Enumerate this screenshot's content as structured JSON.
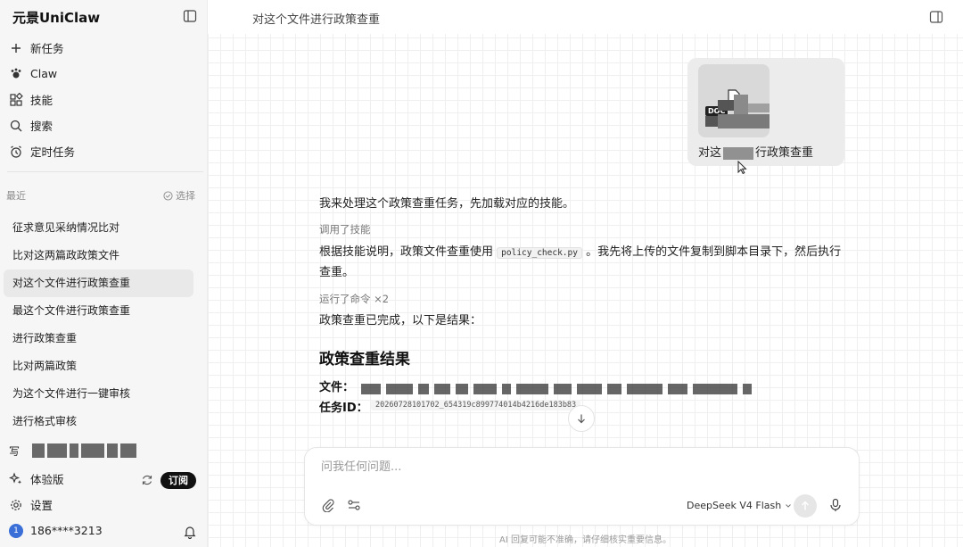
{
  "app": {
    "brand": "元景UniClaw"
  },
  "nav": [
    {
      "label": "新任务",
      "icon": "plus-icon"
    },
    {
      "label": "Claw",
      "icon": "claw-icon"
    },
    {
      "label": "技能",
      "icon": "skills-icon"
    },
    {
      "label": "搜索",
      "icon": "search-icon"
    },
    {
      "label": "定时任务",
      "icon": "alarm-clock-icon"
    }
  ],
  "recent": {
    "heading": "最近",
    "select_label": "选择",
    "items": [
      "征求意见采纳情况比对",
      "比对这两篇政政策文件",
      "对这个文件进行政策查重",
      "最这个文件进行政策查重",
      "进行政策查重",
      "比对两篇政策",
      "为这个文件进行一键审核",
      "进行格式审核"
    ],
    "truncated_item_prefix": "写"
  },
  "bottom": {
    "plan_label": "体验版",
    "subscribe_label": "订阅",
    "settings_label": "设置",
    "account": "186****3213",
    "avatar_initial": "1"
  },
  "header": {
    "title": "对这个文件进行政策查重"
  },
  "attachment": {
    "badge": "DOC",
    "name_prefix": "对这",
    "name_suffix": "行政策查重"
  },
  "conversation": {
    "msg1": "我来处理这个政策查重任务，先加载对应的技能。",
    "meta1": "调用了技能",
    "msg2_before": "根据技能说明，政策文件查重使用",
    "msg2_code": "policy_check.py",
    "msg2_after": "。我先将上传的文件复制到脚本目录下，然后执行查重。",
    "meta2": "运行了命令 ×2",
    "msg3": "政策查重已完成，以下是结果：",
    "result_title": "政策查重结果",
    "file_label": "文件：",
    "taskid_label": "任务ID：",
    "taskid_value": "20260728101702_654319c899774014b4216de183b83"
  },
  "composer": {
    "placeholder": "问我任何问题...",
    "model": "DeepSeek V4 Flash"
  },
  "disclaimer": "AI 回复可能不准确，请仔细核实重要信息。",
  "colors": {
    "accent": "#111111",
    "avatar": "#3a6fd8"
  }
}
